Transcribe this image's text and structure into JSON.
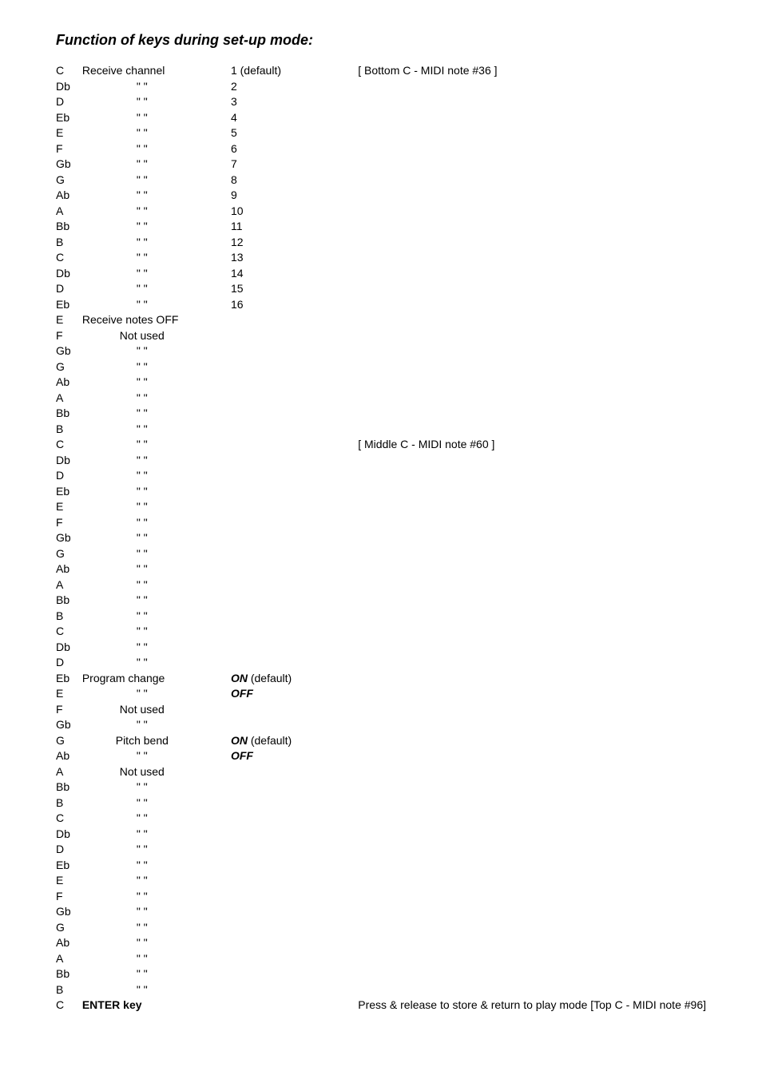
{
  "heading": "Function of keys during set-up mode:",
  "ditto": "\" \"",
  "labels": {
    "receive_channel": "Receive channel",
    "receive_notes_off": "Receive notes OFF",
    "not_used": "Not used",
    "program_change": "Program change",
    "pitch_bend": "Pitch bend",
    "enter_key": "ENTER key"
  },
  "values": {
    "default_1": "1 (default)",
    "v2": "2",
    "v3": "3",
    "v4": "4",
    "v5": "5",
    "v6": "6",
    "v7": "7",
    "v8": "8",
    "v9": "9",
    "v10": "10",
    "v11": "11",
    "v12": "12",
    "v13": "13",
    "v14": "14",
    "v15": "15",
    "v16": "16",
    "on_default_pre": "ON",
    "on_default_suffix": " (default)",
    "off": "OFF"
  },
  "notes": {
    "bottom_c": "[ Bottom C - MIDI note #36 ]",
    "middle_c": "[ Middle C - MIDI note #60 ]",
    "top_c": "Press & release to store & return to play mode [Top C - MIDI note #96]"
  },
  "rows": [
    {
      "key": "C",
      "func": "receive_channel",
      "func_align": "left",
      "val": "default_1",
      "note": "bottom_c"
    },
    {
      "key": "Db",
      "func": "ditto",
      "func_align": "center",
      "val": "v2"
    },
    {
      "key": "D",
      "func": "ditto",
      "func_align": "center",
      "val": "v3"
    },
    {
      "key": "Eb",
      "func": "ditto",
      "func_align": "center",
      "val": "v4"
    },
    {
      "key": "E",
      "func": "ditto",
      "func_align": "center",
      "val": "v5"
    },
    {
      "key": "F",
      "func": "ditto",
      "func_align": "center",
      "val": "v6"
    },
    {
      "key": "Gb",
      "func": "ditto",
      "func_align": "center",
      "val": "v7"
    },
    {
      "key": "G",
      "func": "ditto",
      "func_align": "center",
      "val": "v8"
    },
    {
      "key": "Ab",
      "func": "ditto",
      "func_align": "center",
      "val": "v9"
    },
    {
      "key": "A",
      "func": "ditto",
      "func_align": "center",
      "val": "v10"
    },
    {
      "key": "Bb",
      "func": "ditto",
      "func_align": "center",
      "val": "v11"
    },
    {
      "key": "B",
      "func": "ditto",
      "func_align": "center",
      "val": "v12"
    },
    {
      "key": "C",
      "func": "ditto",
      "func_align": "center",
      "val": "v13"
    },
    {
      "key": "Db",
      "func": "ditto",
      "func_align": "center",
      "val": "v14"
    },
    {
      "key": "D",
      "func": "ditto",
      "func_align": "center",
      "val": "v15"
    },
    {
      "key": "Eb",
      "func": "ditto",
      "func_align": "center",
      "val": "v16"
    },
    {
      "key": "E",
      "func": "receive_notes_off",
      "func_align": "left"
    },
    {
      "key": "F",
      "func": "not_used",
      "func_align": "center"
    },
    {
      "key": "Gb",
      "func": "ditto",
      "func_align": "center"
    },
    {
      "key": "G",
      "func": "ditto",
      "func_align": "center"
    },
    {
      "key": "Ab",
      "func": "ditto",
      "func_align": "center"
    },
    {
      "key": "A",
      "func": "ditto",
      "func_align": "center"
    },
    {
      "key": "Bb",
      "func": "ditto",
      "func_align": "center"
    },
    {
      "key": "B",
      "func": "ditto",
      "func_align": "center"
    },
    {
      "key": "C",
      "func": "ditto",
      "func_align": "center",
      "note": "middle_c"
    },
    {
      "key": "Db",
      "func": "ditto",
      "func_align": "center"
    },
    {
      "key": "D",
      "func": "ditto",
      "func_align": "center"
    },
    {
      "key": "Eb",
      "func": "ditto",
      "func_align": "center"
    },
    {
      "key": "E",
      "func": "ditto",
      "func_align": "center"
    },
    {
      "key": "F",
      "func": "ditto",
      "func_align": "center"
    },
    {
      "key": "Gb",
      "func": "ditto",
      "func_align": "center"
    },
    {
      "key": "G",
      "func": "ditto",
      "func_align": "center"
    },
    {
      "key": "Ab",
      "func": "ditto",
      "func_align": "center"
    },
    {
      "key": "A",
      "func": "ditto",
      "func_align": "center"
    },
    {
      "key": "Bb",
      "func": "ditto",
      "func_align": "center"
    },
    {
      "key": "B",
      "func": "ditto",
      "func_align": "center"
    },
    {
      "key": "C",
      "func": "ditto",
      "func_align": "center"
    },
    {
      "key": "Db",
      "func": "ditto",
      "func_align": "center"
    },
    {
      "key": "D",
      "func": "ditto",
      "func_align": "center"
    },
    {
      "key": "Eb",
      "func": "program_change",
      "func_align": "left",
      "val": "on_default"
    },
    {
      "key": "E",
      "func": "ditto",
      "func_align": "center",
      "val": "off"
    },
    {
      "key": "F",
      "func": "not_used",
      "func_align": "center"
    },
    {
      "key": "Gb",
      "func": "ditto",
      "func_align": "center"
    },
    {
      "key": "G",
      "func": "pitch_bend",
      "func_align": "center",
      "val": "on_default"
    },
    {
      "key": "Ab",
      "func": "ditto",
      "func_align": "center",
      "val": "off"
    },
    {
      "key": "A",
      "func": "not_used",
      "func_align": "center"
    },
    {
      "key": "Bb",
      "func": "ditto",
      "func_align": "center"
    },
    {
      "key": "B",
      "func": "ditto",
      "func_align": "center"
    },
    {
      "key": "C",
      "func": "ditto",
      "func_align": "center"
    },
    {
      "key": "Db",
      "func": "ditto",
      "func_align": "center"
    },
    {
      "key": "D",
      "func": "ditto",
      "func_align": "center"
    },
    {
      "key": "Eb",
      "func": "ditto",
      "func_align": "center"
    },
    {
      "key": "E",
      "func": "ditto",
      "func_align": "center"
    },
    {
      "key": "F",
      "func": "ditto",
      "func_align": "center"
    },
    {
      "key": "Gb",
      "func": "ditto",
      "func_align": "center"
    },
    {
      "key": "G",
      "func": "ditto",
      "func_align": "center"
    },
    {
      "key": "Ab",
      "func": "ditto",
      "func_align": "center"
    },
    {
      "key": "A",
      "func": "ditto",
      "func_align": "center"
    },
    {
      "key": "Bb",
      "func": "ditto",
      "func_align": "center"
    },
    {
      "key": "B",
      "func": "ditto",
      "func_align": "center"
    },
    {
      "key": "C",
      "func": "enter_key",
      "func_align": "left",
      "func_bold": true,
      "note": "top_c"
    }
  ]
}
